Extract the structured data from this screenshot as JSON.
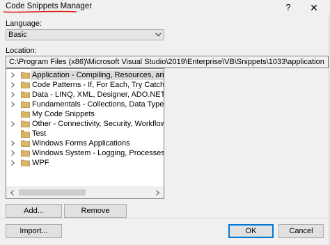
{
  "window": {
    "title": "Code Snippets Manager",
    "help_glyph": "?",
    "close_glyph": "✕"
  },
  "language": {
    "label": "Language:",
    "selected": "Basic"
  },
  "location": {
    "label": "Location:",
    "path": "C:\\Program Files (x86)\\Microsoft Visual Studio\\2019\\Enterprise\\VB\\Snippets\\1033\\application"
  },
  "tree": {
    "items": [
      {
        "label": "Application - Compiling, Resources, and Settin",
        "expandable": true,
        "selected": true,
        "icon": "folder-icon"
      },
      {
        "label": "Code Patterns - If, For Each, Try Catch, Property",
        "expandable": true,
        "selected": false,
        "icon": "folder-icon"
      },
      {
        "label": "Data - LINQ, XML, Designer, ADO.NET",
        "expandable": true,
        "selected": false,
        "icon": "folder-icon"
      },
      {
        "label": "Fundamentals - Collections, Data Types, File Sy",
        "expandable": true,
        "selected": false,
        "icon": "folder-icon"
      },
      {
        "label": "My Code Snippets",
        "expandable": false,
        "selected": false,
        "icon": "folder-icon"
      },
      {
        "label": "Other - Connectivity, Security, Workflow",
        "expandable": true,
        "selected": false,
        "icon": "folder-icon"
      },
      {
        "label": "Test",
        "expandable": false,
        "selected": false,
        "icon": "special-folder-icon"
      },
      {
        "label": "Windows Forms Applications",
        "expandable": true,
        "selected": false,
        "icon": "folder-icon"
      },
      {
        "label": "Windows System - Logging, Processes, Registry",
        "expandable": true,
        "selected": false,
        "icon": "folder-icon"
      },
      {
        "label": "WPF",
        "expandable": true,
        "selected": false,
        "icon": "folder-icon"
      }
    ]
  },
  "buttons": {
    "add": "Add...",
    "remove": "Remove",
    "import": "Import...",
    "ok": "OK",
    "cancel": "Cancel"
  },
  "colors": {
    "folder": "#dcb46a",
    "annotation_underline": "#d9261c",
    "default_button_border": "#0078d7"
  }
}
